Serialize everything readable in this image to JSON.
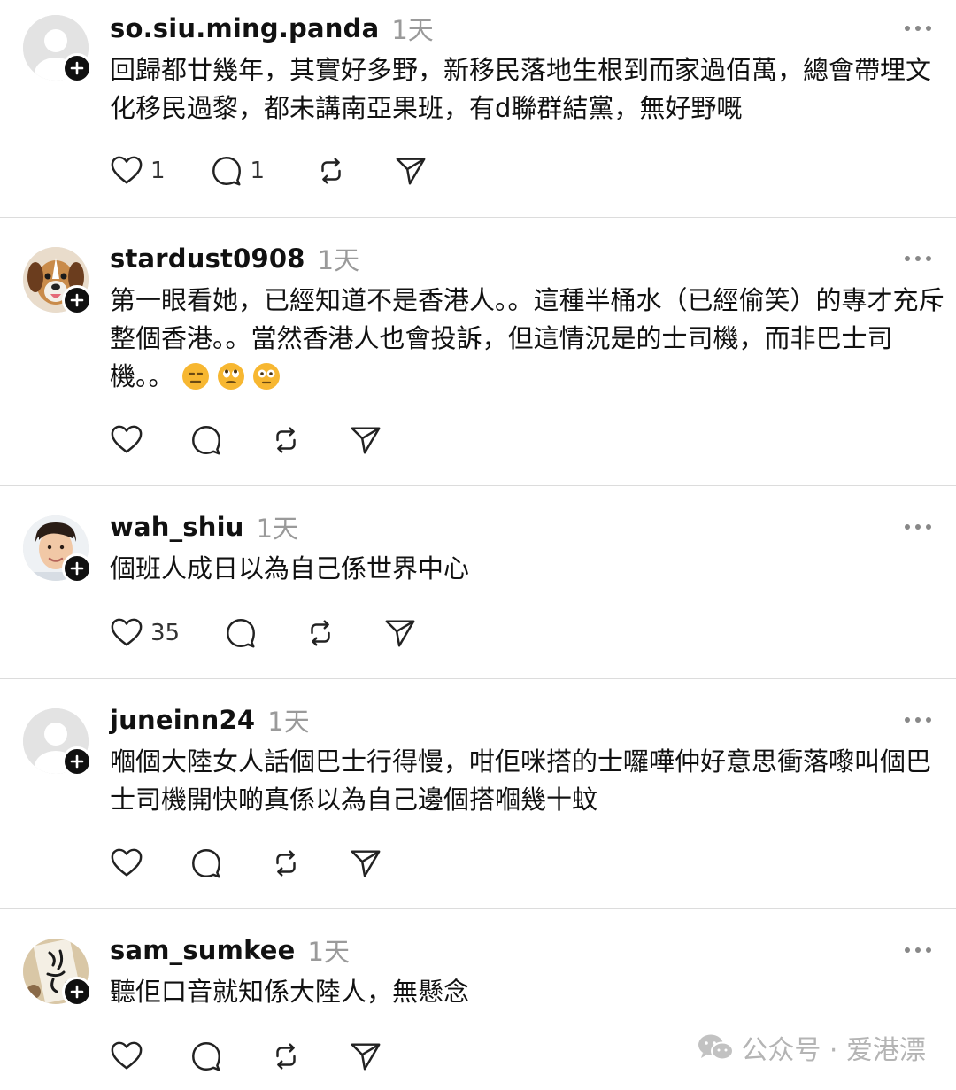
{
  "posts": [
    {
      "username": "so.siu.ming.panda",
      "time": "1天",
      "text": "回歸都廿幾年，其實好多野，新移民落地生根到而家過佰萬，總會帶埋文化移民過黎，都未講南亞果班，有d聯群結黨，無好野嘅",
      "like_count": "1",
      "reply_count": "1",
      "avatar": "default-avatar"
    },
    {
      "username": "stardust0908",
      "time": "1天",
      "text": "第一眼看她，已經知道不是香港人。。這種半桶水（已經偷笑）的專才充斥整個香港。。當然香港人也會投訴，但這情況是的士司機，而非巴士司機。。",
      "like_count": "",
      "reply_count": "",
      "avatar": "dog-photo",
      "emojis": [
        "expressionless-face-emoji",
        "eye-roll-face-emoji",
        "dizzy-face-emoji"
      ]
    },
    {
      "username": "wah_shiu",
      "time": "1天",
      "text": "個班人成日以為自己係世界中心",
      "like_count": "35",
      "reply_count": "",
      "avatar": "person-photo"
    },
    {
      "username": "juneinn24",
      "time": "1天",
      "text": "嗰個大陸女人話個巴士行得慢，咁佢咪搭的士囉嘩仲好意思衝落嚟叫個巴士司機開快啲真係以為自己邊個搭嗰幾十蚊",
      "like_count": "",
      "reply_count": "",
      "avatar": "default-avatar"
    },
    {
      "username": "sam_sumkee",
      "time": "1天",
      "text": "聽佢口音就知係大陸人，無懸念",
      "like_count": "",
      "reply_count": "",
      "avatar": "calligraphy-photo"
    }
  ],
  "watermark": {
    "text": "公众号 · 爱港漂",
    "icon": "wechat-icon"
  },
  "colors": {
    "text": "#111111",
    "muted": "#9a9a9a",
    "divider": "#dcdcdc",
    "badge": "#101010"
  }
}
